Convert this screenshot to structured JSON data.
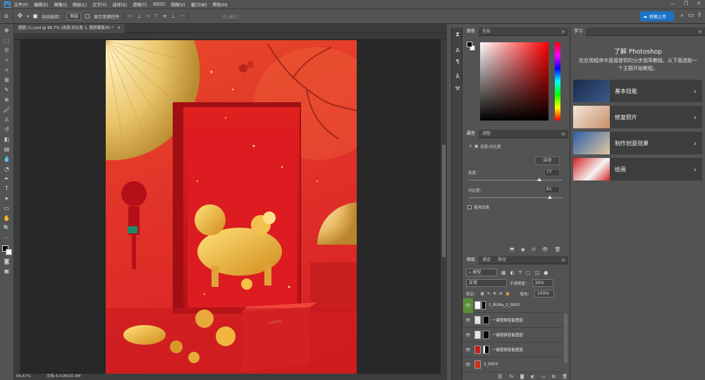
{
  "menu": {
    "items": [
      "文件(F)",
      "编辑(E)",
      "图像(I)",
      "图层(L)",
      "文字(Y)",
      "选择(S)",
      "滤镜(T)",
      "3D(D)",
      "视图(V)",
      "窗口(W)",
      "帮助(H)"
    ]
  },
  "options": {
    "auto_select_label": "自动选择：",
    "auto_select_value": "图层",
    "show_transform_label": "显示变换控件",
    "mode_label": "3D 模式：",
    "cloud_button": "转换上传"
  },
  "document": {
    "tab_title": "圆圆 (1).psd @ 66.7% (亮度/对比度 1, 图层蒙版/8) *",
    "status_zoom": "66.67%",
    "status_doc": "文档:4.01M/20.9M"
  },
  "color_panel": {
    "tabs": [
      "颜色",
      "色板"
    ],
    "hue_color": "#ff0000"
  },
  "properties_panel": {
    "tabs": [
      "属性",
      "调整"
    ],
    "adjustment_name": "亮度/对比度",
    "auto_button": "自动",
    "brightness_label": "亮度：",
    "brightness_value": "77",
    "brightness_level": 77,
    "contrast_label": "对比度：",
    "contrast_value": "81",
    "contrast_level": 81,
    "legacy_label": "使用旧版"
  },
  "layers_panel": {
    "tabs": [
      "图层",
      "通道",
      "路径"
    ],
    "filter_label": "类型",
    "blend_mode": "正常",
    "opacity_label": "不透明度：",
    "opacity_value": "30%",
    "lock_label": "锁定：",
    "fill_label": "填充：",
    "fill_value": "100%",
    "layers": [
      {
        "name": "1_RLMa_2_0053",
        "visible_icon": "eye-icon"
      },
      {
        "name": "一键替换智能图层",
        "visible_icon": "eye-icon"
      },
      {
        "name": "一键替换智能图层",
        "visible_icon": "eye-icon"
      },
      {
        "name": "一键替换智能图层",
        "visible_icon": "eye-icon"
      },
      {
        "name": "3_0053",
        "visible_icon": "eye-icon"
      }
    ]
  },
  "learn_panel": {
    "tab": "学习",
    "heading": "了解 Photoshop",
    "description": "在应用程序中直接提供的分步指导教程。从下面选取一个主题开始教程。",
    "topics": [
      "基本技能",
      "修复照片",
      "制作创意效果",
      "绘画"
    ]
  }
}
